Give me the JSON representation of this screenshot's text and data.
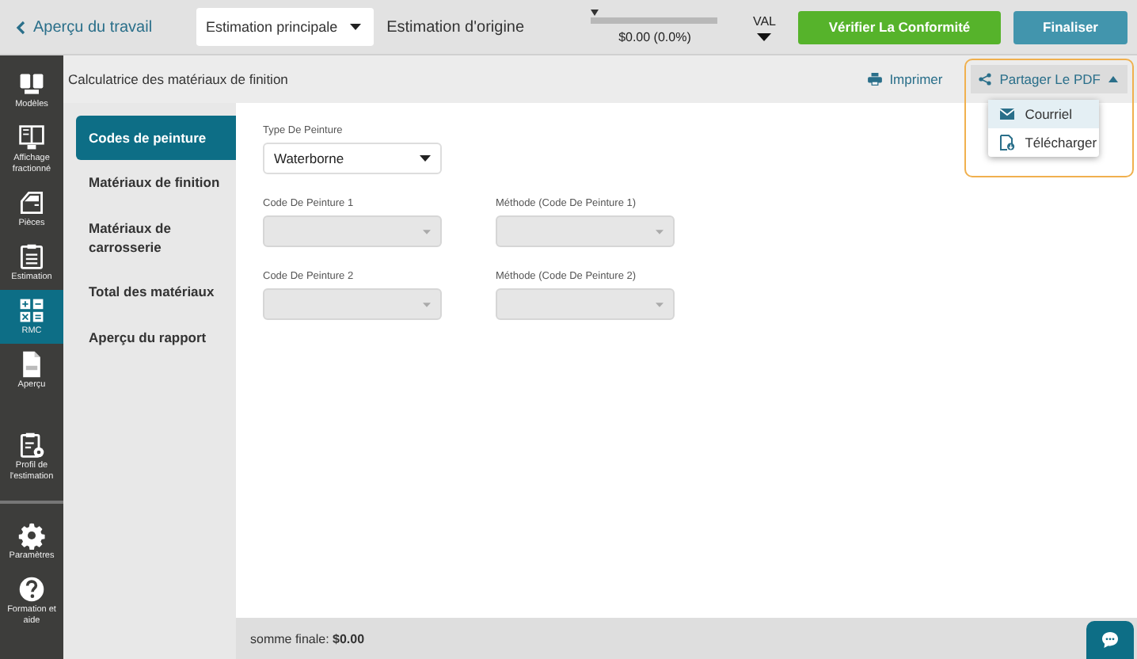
{
  "header": {
    "back_link": "Aperçu du travail",
    "estimate_select": {
      "value": "Estimation principale"
    },
    "estimate_label": "Estimation d'origine",
    "progress": {
      "level": 0,
      "reading": "$0.00 (0.0%)"
    },
    "val_label": "VAL",
    "buttons": [
      {
        "label": "Vérifier La Conformité",
        "kind": "success"
      },
      {
        "label": "Finaliser",
        "kind": "primary"
      }
    ]
  },
  "sidebar": {
    "items": [
      {
        "label": "Modèles",
        "kind": "models",
        "selected": false
      },
      {
        "label": "Affichage fractionné",
        "kind": "split",
        "selected": false
      },
      {
        "label": "Pièces",
        "kind": "parts",
        "selected": false
      },
      {
        "label": "Estimation",
        "kind": "estimate",
        "selected": false
      },
      {
        "label": "RMC",
        "kind": "calc",
        "selected": true
      },
      {
        "label": "Aperçu",
        "kind": "pdf",
        "selected": false
      },
      {
        "label": "Profil de l'estimation",
        "kind": "profile",
        "selected": false
      }
    ],
    "bottom_items": [
      {
        "label": "Paramètres",
        "kind": "settings",
        "selected": false
      },
      {
        "label": "Formation et aide",
        "kind": "help",
        "selected": false
      }
    ]
  },
  "page": {
    "title": "Calculatrice des matériaux de finition",
    "print": "Imprimer",
    "share": {
      "label": "Partager Le PDF",
      "expanded": true,
      "items": [
        {
          "label": "Courriel",
          "kind": "mail",
          "selected": true
        },
        {
          "label": "Télécharger",
          "kind": "download",
          "selected": false
        }
      ]
    }
  },
  "tabs": [
    {
      "label": "Codes de peinture",
      "selected": true
    },
    {
      "label": "Matériaux de finition",
      "selected": false
    },
    {
      "label": "Matériaux de carrosserie",
      "selected": false
    },
    {
      "label": "Total des matériaux",
      "selected": false
    },
    {
      "label": "Aperçu du rapport",
      "selected": false
    }
  ],
  "form": {
    "rows": [
      [
        {
          "label": "Type De Peinture",
          "value": "Waterborne",
          "disabled": false
        }
      ],
      [
        {
          "label": "Code De Peinture 1",
          "disabled": true
        },
        {
          "label": "Méthode (Code De Peinture 1)",
          "disabled": true
        }
      ],
      [
        {
          "label": "Code De Peinture 2",
          "disabled": true
        },
        {
          "label": "Méthode (Code De Peinture 2)",
          "disabled": true
        }
      ]
    ]
  },
  "footer": {
    "total": "somme finale: **$0.00**"
  }
}
